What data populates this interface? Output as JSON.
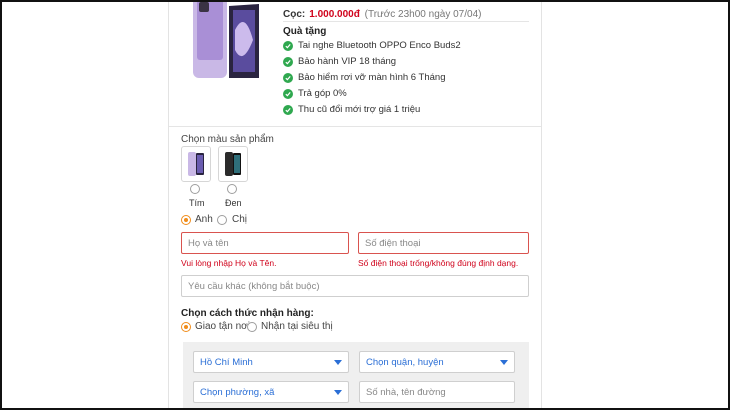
{
  "deposit": {
    "label": "Cọc:",
    "amount": "1.000.000đ",
    "note": "(Trước 23h00 ngày 07/04)"
  },
  "gifts": {
    "title": "Quà tặng",
    "items": [
      "Tai nghe Bluetooth OPPO Enco Buds2",
      "Bảo hành VIP 18 tháng",
      "Bảo hiểm rơi vỡ màn hình 6 Tháng",
      "Trả góp 0%",
      "Thu cũ đổi mới trợ giá 1 triệu"
    ]
  },
  "color": {
    "label": "Chọn màu sản phẩm",
    "options": [
      {
        "name": "Tím",
        "selected": false
      },
      {
        "name": "Đen",
        "selected": false
      }
    ]
  },
  "salutation": {
    "options": [
      {
        "label": "Anh",
        "selected": true
      },
      {
        "label": "Chị",
        "selected": false
      }
    ]
  },
  "form": {
    "name_placeholder": "Họ và tên",
    "phone_placeholder": "Số điện thoại",
    "name_error": "Vui lòng nhập Họ và Tên.",
    "phone_error": "Số điện thoại trống/không đúng định dạng.",
    "note_placeholder": "Yêu cầu khác (không bắt buộc)"
  },
  "shipping": {
    "title": "Chọn cách thức nhận hàng:",
    "options": [
      {
        "label": "Giao tận nơi",
        "selected": true
      },
      {
        "label": "Nhận tại siêu thị",
        "selected": false
      }
    ],
    "province": "Hồ Chí Minh",
    "district": "Chọn quận, huyện",
    "ward": "Chọn phường, xã",
    "street_placeholder": "Số nhà, tên đường"
  },
  "colors": {
    "error": "#d0021b",
    "accent": "#f08c1a",
    "select_text": "#2b6fd6",
    "check": "#2fa84f"
  }
}
